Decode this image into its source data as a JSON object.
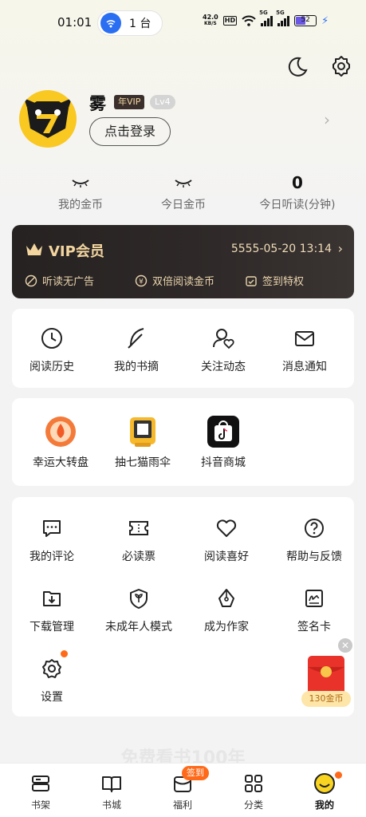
{
  "status_bar": {
    "time": "01:01",
    "hotspot_count": "1 台",
    "net_speed": "42.0",
    "net_unit": "KB/S",
    "hd": "HD",
    "signal1": "5G",
    "signal2": "5G",
    "battery": "52"
  },
  "profile": {
    "name": "雾",
    "vip_badge": "年VIP",
    "level_badge": "Lv4",
    "login_button": "点击登录"
  },
  "stats": [
    {
      "value": "",
      "label": "我的金币"
    },
    {
      "value": "",
      "label": "今日金币"
    },
    {
      "value": "0",
      "label": "今日听读(分钟)"
    }
  ],
  "vip_card": {
    "title": "VIP会员",
    "expire_date": "5555-05-20 13:14",
    "perks": [
      "听读无广告",
      "双倍阅读金币",
      "签到特权"
    ],
    "colors": {
      "bg": "#262221",
      "gold": "#f3d5a0"
    }
  },
  "quick_actions": [
    {
      "label": "阅读历史",
      "icon": "clock-icon"
    },
    {
      "label": "我的书摘",
      "icon": "quill-icon"
    },
    {
      "label": "关注动态",
      "icon": "user-heart-icon"
    },
    {
      "label": "消息通知",
      "icon": "mail-icon"
    }
  ],
  "activities": [
    {
      "label": "幸运大转盘",
      "icon": "lucky-wheel-icon"
    },
    {
      "label": "抽七猫雨伞",
      "icon": "umbrella-prize-icon"
    },
    {
      "label": "抖音商城",
      "icon": "douyin-mall-icon"
    }
  ],
  "services": [
    {
      "label": "我的评论",
      "icon": "comment-icon"
    },
    {
      "label": "必读票",
      "icon": "ticket-icon"
    },
    {
      "label": "阅读喜好",
      "icon": "heart-icon"
    },
    {
      "label": "帮助与反馈",
      "icon": "help-icon"
    },
    {
      "label": "下载管理",
      "icon": "download-icon"
    },
    {
      "label": "未成年人模式",
      "icon": "shield-leaf-icon"
    },
    {
      "label": "成为作家",
      "icon": "pen-nib-icon"
    },
    {
      "label": "签名卡",
      "icon": "signature-card-icon"
    },
    {
      "label": "设置",
      "icon": "settings-gear-icon"
    }
  ],
  "red_packet": {
    "label": "130金币"
  },
  "ghost_text": "免费看书100年",
  "bottom_nav": {
    "sign_badge": "签到",
    "items": [
      {
        "label": "书架",
        "icon": "bookshelf-icon"
      },
      {
        "label": "书城",
        "icon": "book-open-icon"
      },
      {
        "label": "福利",
        "icon": "gift-icon"
      },
      {
        "label": "分类",
        "icon": "grid-icon"
      },
      {
        "label": "我的",
        "icon": "smiley-icon",
        "active": true
      }
    ]
  },
  "colors": {
    "accent": "#ff6a1a",
    "avatar_bg": "#f9c821",
    "status_blue": "#2a6ef2"
  }
}
